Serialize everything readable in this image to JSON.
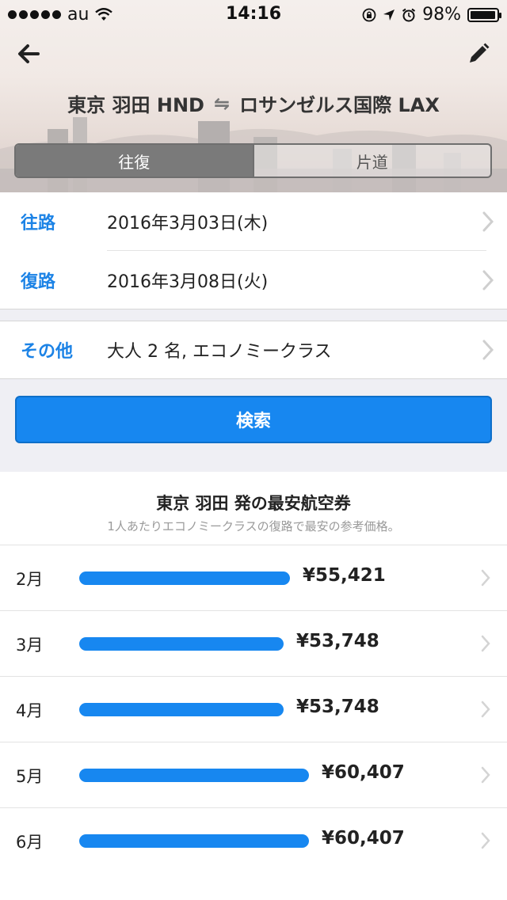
{
  "status_bar": {
    "carrier": "au",
    "time": "14:16",
    "battery": "98%",
    "battery_level": 0.98
  },
  "nav": {
    "back_icon": "arrow-left-icon",
    "edit_icon": "pencil-icon"
  },
  "route": {
    "origin": "東京 羽田 HND",
    "swap_symbol": "⇋",
    "destination": "ロサンゼルス国際 LAX"
  },
  "trip_type": {
    "round_trip": "往復",
    "one_way": "片道",
    "selected": "round_trip"
  },
  "form": {
    "outbound_label": "往路",
    "outbound_value": "2016年3月03日(木)",
    "return_label": "復路",
    "return_value": "2016年3月08日(火)",
    "other_label": "その他",
    "other_value": "大人 2 名, エコノミークラス"
  },
  "search_button": "検索",
  "cheapest": {
    "title": "東京 羽田 発の最安航空券",
    "subtitle": "1人あたりエコノミークラスの復路で最安の参考価格。",
    "rows": [
      {
        "month": "2月",
        "price": "¥55,421",
        "value": 55421
      },
      {
        "month": "3月",
        "price": "¥53,748",
        "value": 53748
      },
      {
        "month": "4月",
        "price": "¥53,748",
        "value": 53748
      },
      {
        "month": "5月",
        "price": "¥60,407",
        "value": 60407
      },
      {
        "month": "6月",
        "price": "¥60,407",
        "value": 60407
      }
    ]
  },
  "colors": {
    "accent": "#1787f0",
    "label_blue": "#1c83e6"
  }
}
